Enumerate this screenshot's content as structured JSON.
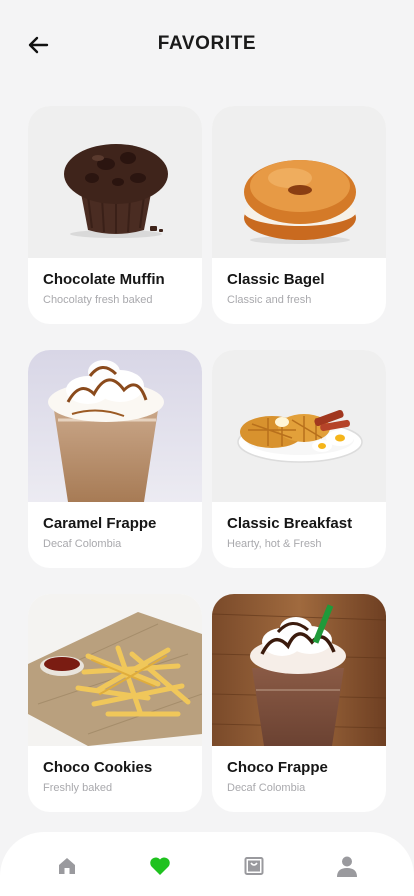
{
  "header": {
    "title": "FAVORITE",
    "back_icon": "arrow-left-icon"
  },
  "favorites": [
    {
      "title": "Chocolate Muffin",
      "subtitle": "Chocolaty fresh baked",
      "image": "chocolate-muffin-image"
    },
    {
      "title": "Classic Bagel",
      "subtitle": "Classic and fresh",
      "image": "bagel-image"
    },
    {
      "title": "Caramel Frappe",
      "subtitle": "Decaf Colombia",
      "image": "caramel-frappe-image"
    },
    {
      "title": "Classic Breakfast",
      "subtitle": "Hearty, hot & Fresh",
      "image": "waffle-breakfast-image"
    },
    {
      "title": "Choco Cookies",
      "subtitle": "Freshly baked",
      "image": "french-fries-image"
    },
    {
      "title": "Choco Frappe",
      "subtitle": "Decaf Colombia",
      "image": "choco-frappe-image"
    }
  ],
  "bottom_nav": {
    "items": [
      {
        "icon": "home-icon",
        "active": false
      },
      {
        "icon": "heart-icon",
        "active": true
      },
      {
        "icon": "bag-icon",
        "active": false
      },
      {
        "icon": "profile-icon",
        "active": false
      }
    ],
    "active_color": "#1fc21f",
    "inactive_color": "#9a9a9e"
  }
}
